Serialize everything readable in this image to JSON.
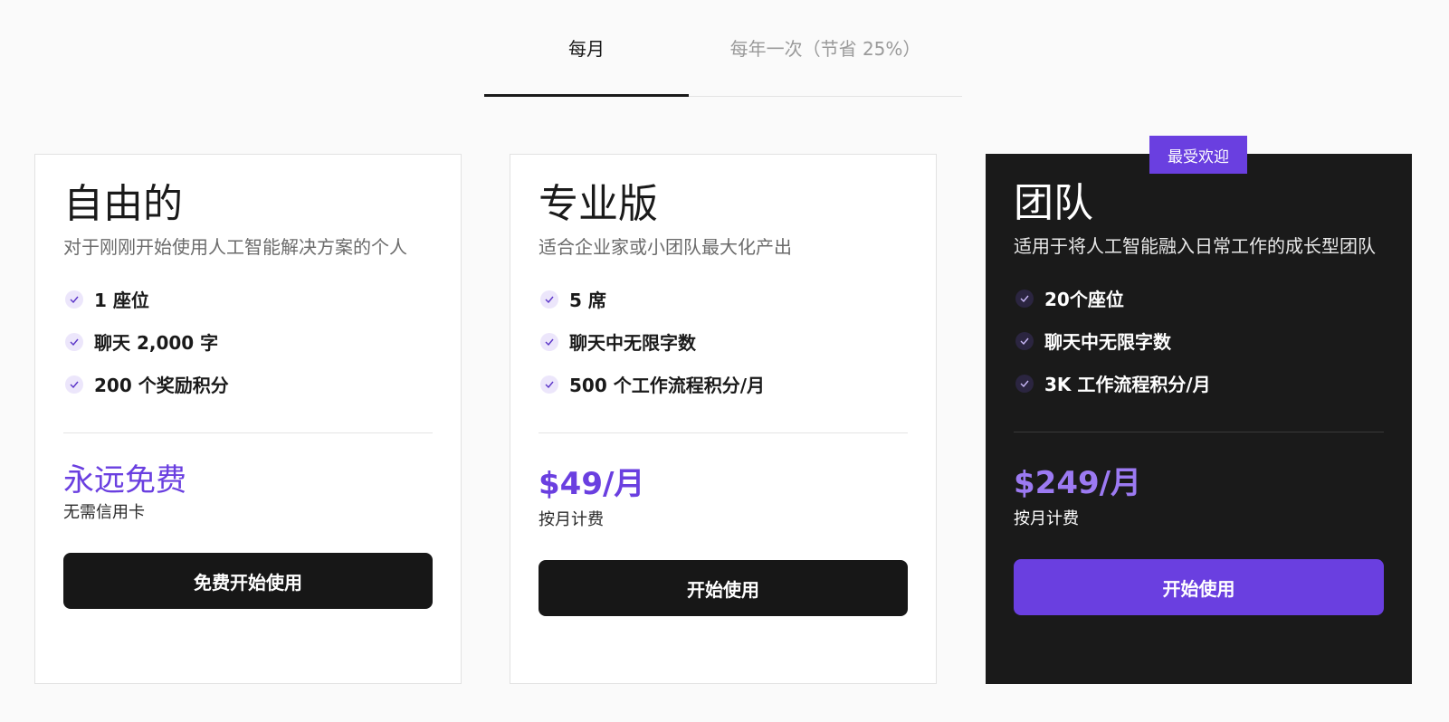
{
  "billing_tabs": {
    "monthly": "每月",
    "annual": "每年一次（节省 25%）"
  },
  "badge": "最受欢迎",
  "plans": [
    {
      "title": "自由的",
      "description": "对于刚刚开始使用人工智能解决方案的个人",
      "features": [
        "1 座位",
        "聊天 2,000 字",
        "200 个奖励积分"
      ],
      "price": "永远免费",
      "price_sub": "无需信用卡",
      "cta": "免费开始使用"
    },
    {
      "title": "专业版",
      "description": "适合企业家或小团队最大化产出",
      "features": [
        "5 席",
        "聊天中无限字数",
        "500 个工作流程积分/月"
      ],
      "price": "$49/月",
      "price_sub": "按月计费",
      "cta": "开始使用"
    },
    {
      "title": "团队",
      "description": "适用于将人工智能融入日常工作的成长型团队",
      "features": [
        "20个座位",
        "聊天中无限字数",
        "3K 工作流程积分/月"
      ],
      "price": "$249/月",
      "price_sub": "按月计费",
      "cta": "开始使用"
    }
  ],
  "colors": {
    "accent": "#6a3fe0",
    "dark": "#1a1a1a",
    "background": "#fafafa"
  },
  "icons": {
    "feature": "check-icon"
  }
}
